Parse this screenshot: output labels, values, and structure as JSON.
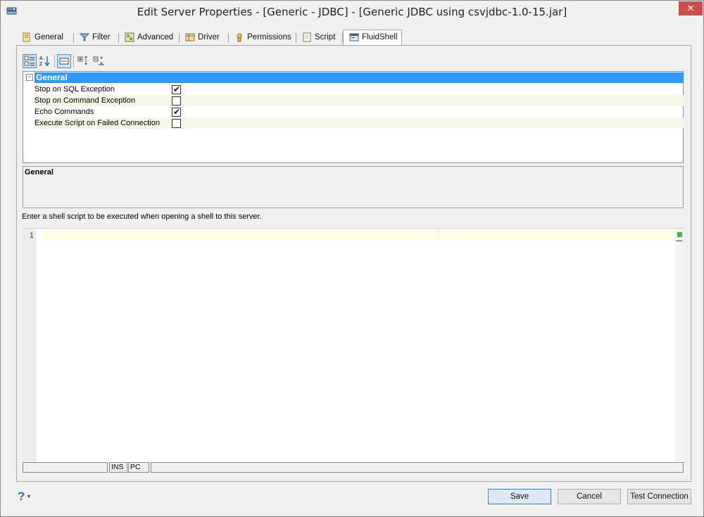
{
  "window": {
    "title": "Edit Server Properties - [Generic - JDBC] - [Generic JDBC using csvjdbc-1.0-15.jar]",
    "close_label": "✕"
  },
  "tabs": [
    {
      "label": "General",
      "icon": "general-icon"
    },
    {
      "label": "Filter",
      "icon": "filter-icon"
    },
    {
      "label": "Advanced",
      "icon": "advanced-icon"
    },
    {
      "label": "Driver",
      "icon": "driver-icon"
    },
    {
      "label": "Permissions",
      "icon": "permissions-icon"
    },
    {
      "label": "Script",
      "icon": "script-icon"
    },
    {
      "label": "FluidShell",
      "icon": "fluidshell-icon",
      "active": true
    }
  ],
  "toolbar": {
    "categorized": "categorized-icon",
    "alphabetical": "sort-az-icon",
    "property_pages": "property-pages-icon",
    "expand_all": "expand-all-icon",
    "collapse_all": "collapse-all-icon"
  },
  "propgrid": {
    "category": "General",
    "collapse_glyph": "−",
    "rows": [
      {
        "label": "Stop on SQL Exception",
        "checked": true
      },
      {
        "label": "Stop on Command Exception",
        "checked": false
      },
      {
        "label": "Echo Commands",
        "checked": true
      },
      {
        "label": "Execute Script on Failed Connection",
        "checked": false
      }
    ]
  },
  "description": {
    "title": "General"
  },
  "hint": "Enter a shell script to be executed when opening a shell to this server.",
  "editor": {
    "line_number": "1",
    "content": ""
  },
  "statusbar": {
    "position": "",
    "mode": "INS",
    "line_ending": "PC",
    "message": ""
  },
  "footer": {
    "help_label": "?",
    "help_caret": "▾",
    "save_label": "Save",
    "cancel_label": "Cancel",
    "test_label": "Test Connection"
  },
  "colors": {
    "accent": "#3399ff",
    "current_line": "#fffde3",
    "ok_status": "#4caf50"
  }
}
